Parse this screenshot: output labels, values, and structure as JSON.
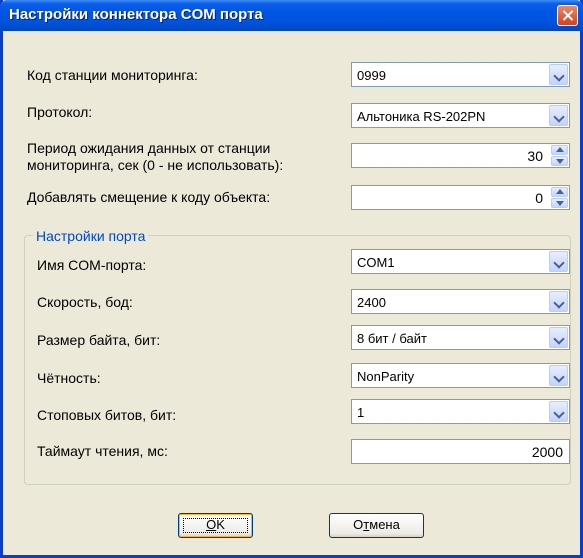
{
  "window": {
    "title": "Настройки коннектора COM порта"
  },
  "fields": {
    "station_code_label": "Код станции мониторинга:",
    "station_code_value": "0999",
    "protocol_label": "Протокол:",
    "protocol_value": "Альтоника RS-202PN",
    "timeout_label": "Период ожидания данных от станции мониторинга, сек (0 - не использовать):",
    "timeout_value": "30",
    "offset_label": "Добавлять смещение к коду объекта:",
    "offset_value": "0"
  },
  "port": {
    "group_title": "Настройки порта",
    "name_label": "Имя COM-порта:",
    "name_value": "COM1",
    "speed_label": "Скорость, бод:",
    "speed_value": "2400",
    "bytesize_label": "Размер байта, бит:",
    "bytesize_value": "8 бит / байт",
    "parity_label": "Чётность:",
    "parity_value": "NonParity",
    "stopbits_label": "Стоповых битов, бит:",
    "stopbits_value": "1",
    "readtimeout_label": "Таймаут чтения, мс:",
    "readtimeout_value": "2000"
  },
  "buttons": {
    "ok_accel": "O",
    "ok_rest": "K",
    "cancel_pre": "О",
    "cancel_accel": "т",
    "cancel_rest": "мена"
  },
  "icons": {
    "close": "close-icon",
    "dropdown": "chevron-down-icon",
    "spin_up": "spin-up-icon",
    "spin_down": "spin-down-icon"
  },
  "colors": {
    "titlebar": "#0054e3",
    "dialog_bg": "#ece9d8",
    "group_title": "#0046d5",
    "close_button": "#d4411f"
  }
}
